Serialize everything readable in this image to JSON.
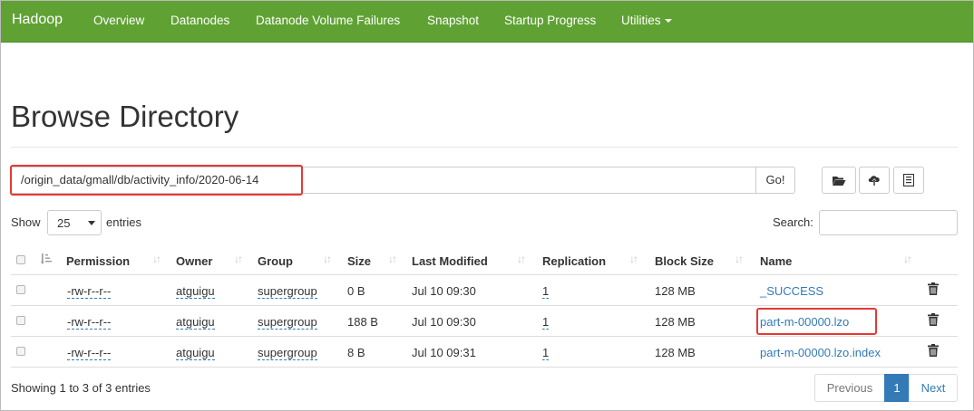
{
  "navbar": {
    "brand": "Hadoop",
    "items": [
      "Overview",
      "Datanodes",
      "Datanode Volume Failures",
      "Snapshot",
      "Startup Progress",
      "Utilities"
    ]
  },
  "page_title": "Browse Directory",
  "path_bar": {
    "value": "/origin_data/gmall/db/activity_info/2020-06-14",
    "go_label": "Go!",
    "icons": [
      "folder-icon",
      "upload-icon",
      "list-icon"
    ]
  },
  "entries": {
    "show_label": "Show",
    "selected": "25",
    "suffix": "entries"
  },
  "search": {
    "label": "Search:",
    "value": ""
  },
  "table": {
    "columns": [
      "Permission",
      "Owner",
      "Group",
      "Size",
      "Last Modified",
      "Replication",
      "Block Size",
      "Name"
    ],
    "rows": [
      {
        "permission": "-rw-r--r--",
        "owner": "atguigu",
        "group": "supergroup",
        "size": "0 B",
        "modified": "Jul 10 09:30",
        "replication": "1",
        "block_size": "128 MB",
        "name": "_SUCCESS"
      },
      {
        "permission": "-rw-r--r--",
        "owner": "atguigu",
        "group": "supergroup",
        "size": "188 B",
        "modified": "Jul 10 09:30",
        "replication": "1",
        "block_size": "128 MB",
        "name": "part-m-00000.lzo"
      },
      {
        "permission": "-rw-r--r--",
        "owner": "atguigu",
        "group": "supergroup",
        "size": "8 B",
        "modified": "Jul 10 09:31",
        "replication": "1",
        "block_size": "128 MB",
        "name": "part-m-00000.lzo.index"
      }
    ]
  },
  "footer": {
    "info": "Showing 1 to 3 of 3 entries",
    "previous": "Previous",
    "page": "1",
    "next": "Next"
  },
  "colors": {
    "navbar": "#5fa233",
    "link": "#337ab7",
    "highlight": "#e53935"
  }
}
